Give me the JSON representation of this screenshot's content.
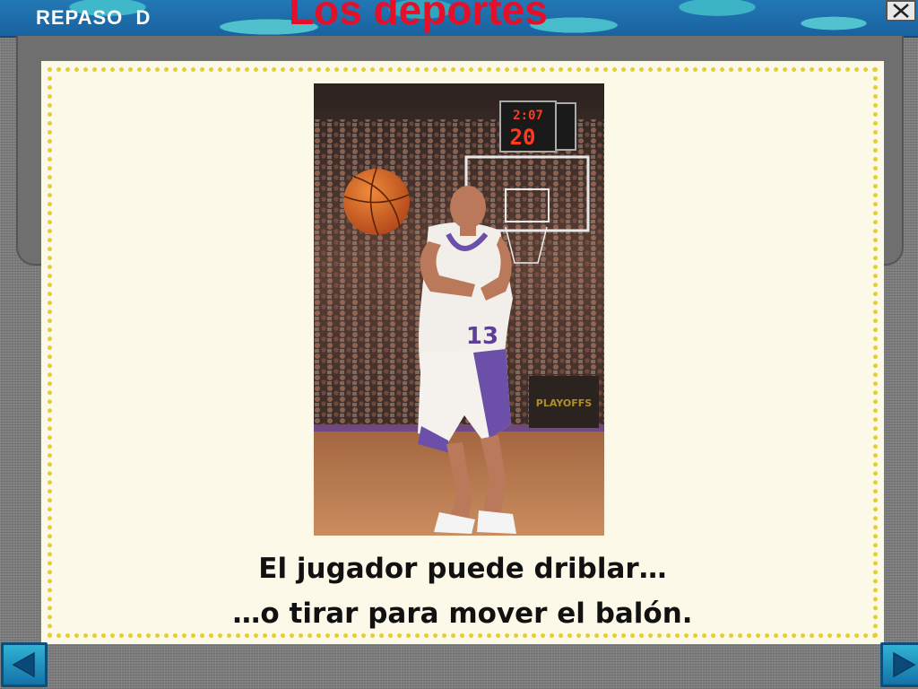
{
  "header": {
    "section_label": "REPASO  D",
    "title": "Los deportes",
    "close_icon": "close-x-icon"
  },
  "slide": {
    "image": {
      "subject": "basketball-player-passing-photo",
      "jersey_number": "13",
      "scoreboard_top": "2:07",
      "scoreboard_bottom": "20"
    },
    "caption_line1": "El jugador puede driblar…",
    "caption_line2": "…o tirar para mover el balón."
  },
  "navigation": {
    "prev_icon": "arrow-left-icon",
    "next_icon": "arrow-right-icon"
  },
  "colors": {
    "header_blue": "#1f6fad",
    "title_red": "#e4102a",
    "card_bg": "#fdf9e9",
    "dotted_border": "#e3cf32",
    "nav_button": "#1e90c0"
  }
}
